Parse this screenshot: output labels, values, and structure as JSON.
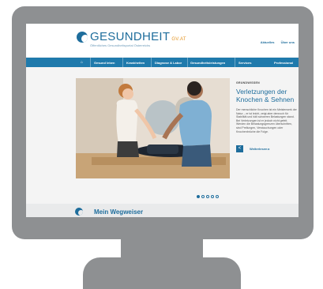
{
  "header": {
    "logo_text": "GESUNDHEIT",
    "logo_suffix": "GV.AT",
    "logo_subtitle": "Öffentliches Gesundheitsportal Österreichs",
    "links": [
      "Aktuelles",
      "Über uns"
    ]
  },
  "nav": {
    "home_icon": "home-icon",
    "items": [
      "Gesund leben",
      "Krankheiten",
      "Diagnose & Labor",
      "Gesundheitsleistungen",
      "Services",
      "Professional"
    ]
  },
  "hero": {
    "image_description_icon": "photo-physiotherapy"
  },
  "feature": {
    "kicker": "GRUNDWISSEN",
    "title": "Verletzungen der Knochen & Sehnen",
    "body": "Der menschliche Knochen ist ein Meisterwerk der Natur – er ist leicht, zeigt aber dennoch für Stabilität und hält schweren Belastungen stand. Bei Verletzungen ist er jedoch nicht gefeit. Werden die Belastungsgrenzen überschritten, sind Prellungen, Verstauchungen oder Knochenbrüche die Folge.",
    "button_icon": "share-icon",
    "link_label": "Weiterlesen ▸"
  },
  "carousel": {
    "count": 5,
    "active_index": 0
  },
  "bottom": {
    "title": "Mein Wegweiser"
  },
  "colors": {
    "brand": "#1e6d9c",
    "nav": "#1f7aac",
    "accent": "#e49524",
    "frame": "#8e9092"
  }
}
